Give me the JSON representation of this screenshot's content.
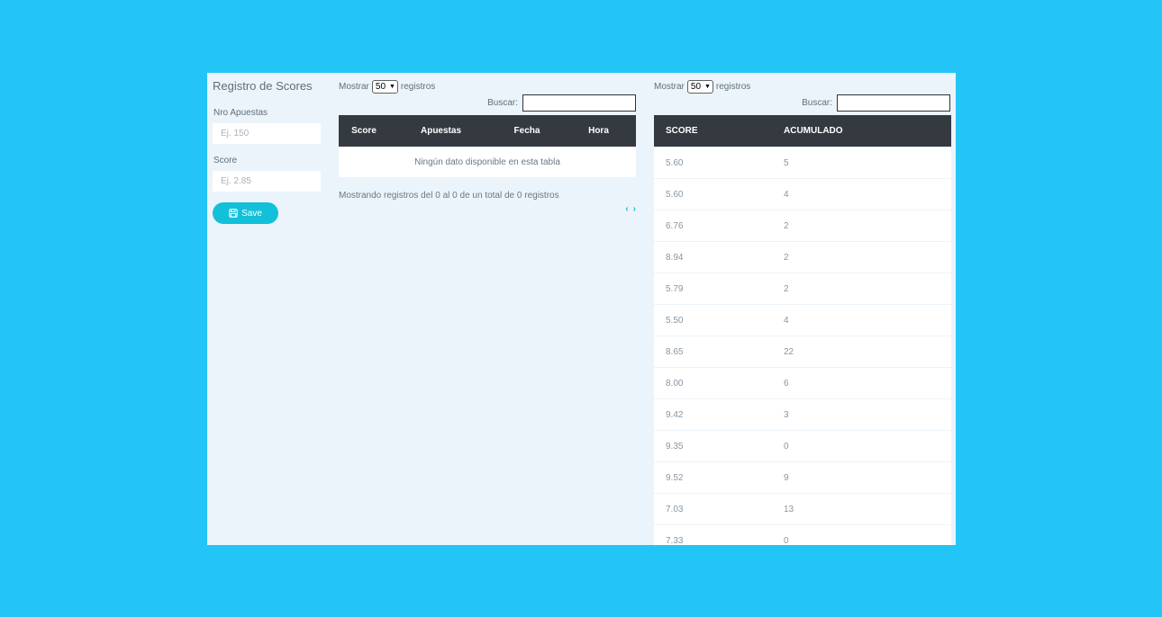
{
  "form": {
    "title": "Registro de Scores",
    "apuestas_label": "Nro Apuestas",
    "apuestas_placeholder": "Ej. 150",
    "score_label": "Score",
    "score_placeholder": "Ej. 2.85",
    "save_label": "Save"
  },
  "left_table": {
    "show_prefix": "Mostrar",
    "show_value": "50",
    "show_suffix": "registros",
    "search_label": "Buscar:",
    "columns": [
      "Score",
      "Apuestas",
      "Fecha",
      "Hora"
    ],
    "empty_message": "Ningún dato disponible en esta tabla",
    "info": "Mostrando registros del 0 al 0 de un total de 0 registros",
    "prev": "‹",
    "next": "›"
  },
  "right_table": {
    "show_prefix": "Mostrar",
    "show_value": "50",
    "show_suffix": "registros",
    "search_label": "Buscar:",
    "columns": [
      "SCORE",
      "ACUMULADO"
    ],
    "rows": [
      [
        "5.60",
        "5"
      ],
      [
        "5.60",
        "4"
      ],
      [
        "6.76",
        "2"
      ],
      [
        "8.94",
        "2"
      ],
      [
        "5.79",
        "2"
      ],
      [
        "5.50",
        "4"
      ],
      [
        "8.65",
        "22"
      ],
      [
        "8.00",
        "6"
      ],
      [
        "9.42",
        "3"
      ],
      [
        "9.35",
        "0"
      ],
      [
        "9.52",
        "9"
      ],
      [
        "7.03",
        "13"
      ],
      [
        "7.33",
        "0"
      ]
    ]
  },
  "colors": {
    "page_background": "#22c5f6",
    "panel_background": "#ebf4fa",
    "header_background": "#343a40",
    "accent": "#12c0d9"
  }
}
